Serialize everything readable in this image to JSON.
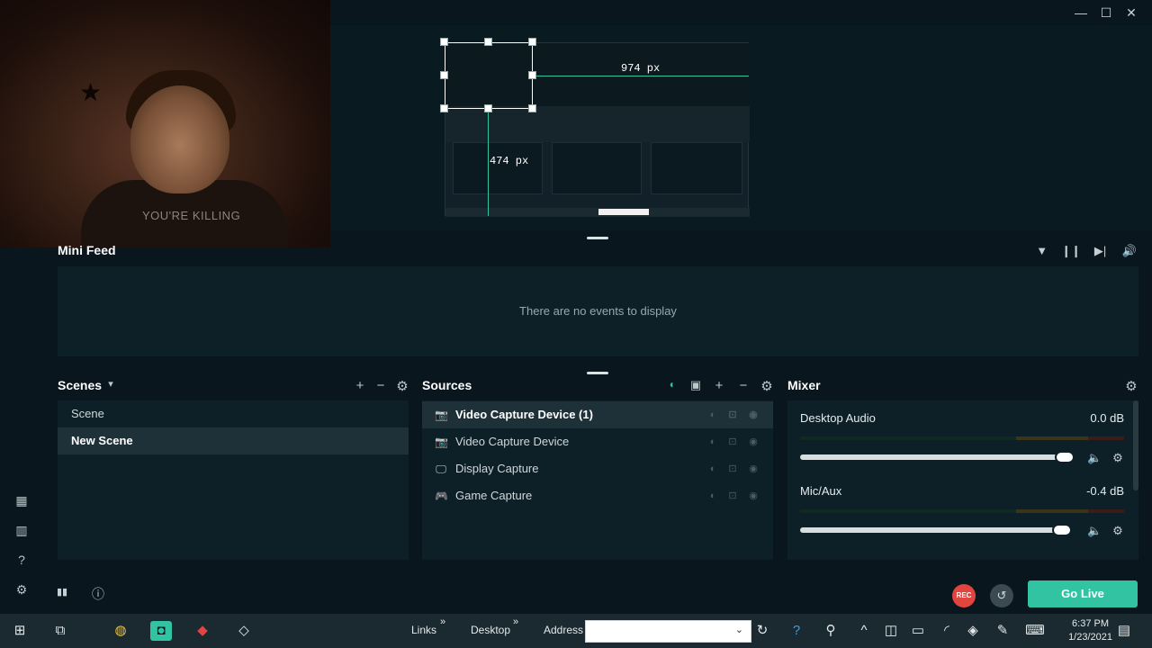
{
  "window": {
    "min": "—",
    "max": "☐",
    "close": "✕"
  },
  "rail": {
    "icons": [
      "grid-icon",
      "columns-icon",
      "help-icon",
      "settings-icon"
    ],
    "glyphs": [
      "▦",
      "▥",
      "?",
      "⚙"
    ]
  },
  "preview": {
    "width_label": "974 px",
    "height_label": "474 px"
  },
  "webcam": {
    "shirt_text": "YOU'RE KILLING"
  },
  "mini_feed": {
    "title": "Mini Feed",
    "empty_text": "There are no events to display",
    "tools": {
      "filter": "▼",
      "pause": "❙❙",
      "skip": "▶|",
      "volume": "🔊"
    }
  },
  "scenes": {
    "title": "Scenes",
    "dropdown": "▾",
    "add": "+",
    "remove": "−",
    "settings": "⚙",
    "items": [
      {
        "label": "Scene",
        "active": false
      },
      {
        "label": "New Scene",
        "active": true
      }
    ]
  },
  "sources": {
    "title": "Sources",
    "add_folder": "▣",
    "add": "+",
    "remove": "−",
    "settings": "⚙",
    "items": [
      {
        "label": "Video Capture Device (1)",
        "icon": "📷",
        "active": true
      },
      {
        "label": "Video Capture Device",
        "icon": "📷",
        "active": false
      },
      {
        "label": "Display Capture",
        "icon": "🖵",
        "active": false
      },
      {
        "label": "Game Capture",
        "icon": "🎮",
        "active": false
      }
    ]
  },
  "mixer": {
    "title": "Mixer",
    "settings": "⚙",
    "channels": [
      {
        "name": "Desktop Audio",
        "db": "0.0 dB",
        "volume": 0.98
      },
      {
        "name": "Mic/Aux",
        "db": "-0.4 dB",
        "volume": 0.97
      }
    ]
  },
  "footer": {
    "stats_icon": "▮▮",
    "info_icon": "ⓘ",
    "rec_label": "REC",
    "replay_icon": "↺",
    "golive_label": "Go Live"
  },
  "taskbar": {
    "links_label": "Links",
    "desktop_label": "Desktop",
    "address_label": "Address",
    "chevron": "»",
    "time": "6:37 PM",
    "date": "1/23/2021"
  }
}
